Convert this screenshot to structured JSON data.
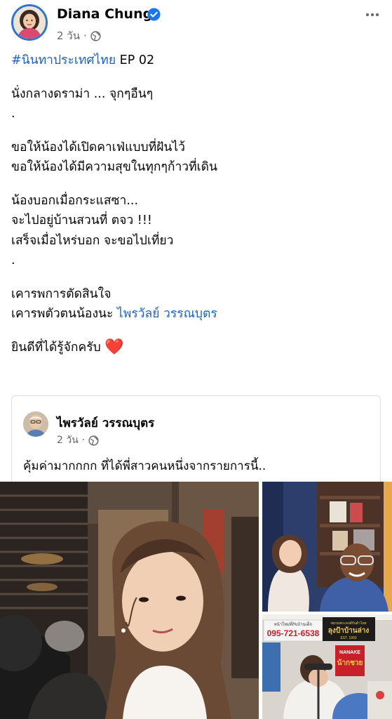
{
  "post": {
    "author": "Diana Chung",
    "time": "2 วัน",
    "lines": [
      {
        "segments": [
          {
            "text": "#นินทาประเทศไทย",
            "link": true
          },
          {
            "text": " EP 02",
            "link": false
          }
        ]
      },
      {
        "gap": true
      },
      {
        "segments": [
          {
            "text": "นั่งกลางดราม่า ... จุกๆอืนๆ",
            "link": false
          }
        ]
      },
      {
        "segments": [
          {
            "text": ".",
            "link": false
          }
        ]
      },
      {
        "gap": true
      },
      {
        "segments": [
          {
            "text": "ขอให้น้องได้เปิดคาเฟ่แบบที่ฝันไว้",
            "link": false
          }
        ]
      },
      {
        "segments": [
          {
            "text": "ขอให้น้องได้มีความสุขในทุกๆก้าวที่เดิน",
            "link": false
          }
        ]
      },
      {
        "gap": true
      },
      {
        "segments": [
          {
            "text": "น้องบอกเมื่อกระแสซา...",
            "link": false
          }
        ]
      },
      {
        "segments": [
          {
            "text": "จะไปอยู่บ้านสวนที่ ตจว !!!",
            "link": false
          }
        ]
      },
      {
        "segments": [
          {
            "text": "เสร็จเมื่อไหร่บอก จะขอไปเที่ยว",
            "link": false
          }
        ]
      },
      {
        "segments": [
          {
            "text": ".",
            "link": false
          }
        ]
      },
      {
        "gap": true
      },
      {
        "segments": [
          {
            "text": "เคารพการตัดสินใจ",
            "link": false
          }
        ]
      },
      {
        "segments": [
          {
            "text": "เคารพตัวตนน้องนะ ",
            "link": false
          },
          {
            "text": "ไพรวัลย์ วรรณบุตร",
            "link": true
          }
        ]
      },
      {
        "gap": true
      },
      {
        "segments": [
          {
            "text": "ยินดีที่ได้รู้จักครับ ",
            "link": false
          },
          {
            "text": "❤️",
            "link": false,
            "heart": true
          }
        ]
      }
    ]
  },
  "shared": {
    "author": "ไพรวัลย์ วรรณบุตร",
    "time": "2 วัน",
    "text": "คุ้มค่ามากกกก ที่ได้พี่สาวคนหนึ่งจากรายการนี้.."
  },
  "photo3_sign": {
    "top_text": "หน้าใหม่ที่กับบ้านเด็ก",
    "phone": "095-721-6538",
    "brand_top": "ลุงป้าบ้านล่าง",
    "est": "EST. 1993",
    "brand_left": "NANAKE",
    "brand_left_sub": "น้ากชวย"
  },
  "colors": {
    "link": "#1b63c9",
    "verified": "#1877f2",
    "meta": "#65676b",
    "heart": "#e0243b"
  },
  "icons": {
    "verified": "verified-badge-icon",
    "globe": "globe-icon",
    "more": "more-options-icon"
  }
}
